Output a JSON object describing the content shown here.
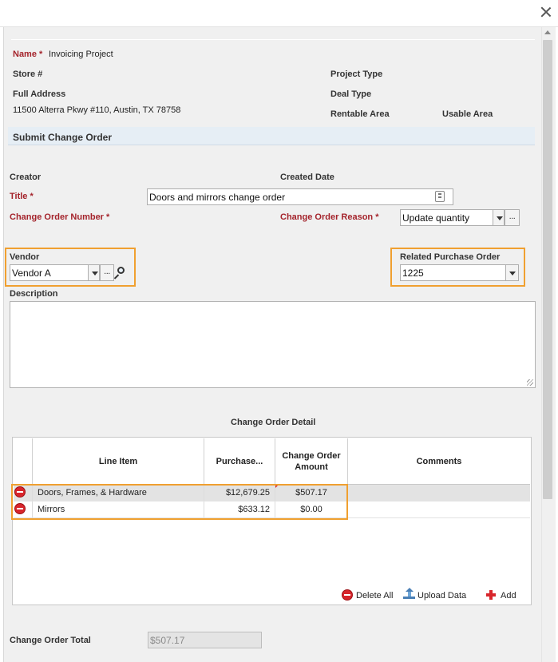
{
  "project": {
    "name_label": "Name",
    "name_req": "*",
    "name_value": "Invoicing Project",
    "store_label": "Store #",
    "address_label": "Full Address",
    "address_value": "11500 Alterra Pkwy #110, Austin, TX 78758",
    "project_type_label": "Project Type",
    "deal_type_label": "Deal Type",
    "rentable_area_label": "Rentable Area",
    "usable_area_label": "Usable Area"
  },
  "section": {
    "title": "Submit Change Order"
  },
  "form": {
    "creator_label": "Creator",
    "created_date_label": "Created Date",
    "title_label": "Title *",
    "title_value": "Doors and mirrors change order",
    "number_label": "Change Order Number *",
    "reason_label": "Change Order Reason *",
    "reason_value": "Update quantity",
    "vendor_label": "Vendor",
    "vendor_value": "Vendor A",
    "po_label": "Related Purchase Order",
    "po_value": "1225",
    "description_label": "Description",
    "ellipsis": "..."
  },
  "detail": {
    "title": "Change Order Detail",
    "columns": [
      "Line Item",
      "Purchase...",
      "Change Order Amount",
      "Comments"
    ],
    "rows": [
      {
        "line_item": "Doors, Frames, & Hardware",
        "purchase": "$12,679.25",
        "amount": "$507.17",
        "comments": ""
      },
      {
        "line_item": "Mirrors",
        "purchase": "$633.12",
        "amount": "$0.00",
        "comments": ""
      }
    ],
    "toolbar": {
      "delete_all": "Delete All",
      "upload": "Upload Data",
      "add": "Add"
    }
  },
  "total": {
    "label": "Change Order Total",
    "value": "$507.17"
  },
  "icons": {
    "close": "close-icon",
    "lookup": "magnifier-icon",
    "remove": "remove-row-icon",
    "upload": "upload-icon",
    "add": "plus-icon",
    "dropdown": "chevron-down-icon",
    "field_picker": "field-picker-icon"
  },
  "colors": {
    "required": "#a4232b",
    "highlight": "#f0a030",
    "section_bar": "#e6eef5",
    "remove": "#d8262c"
  }
}
